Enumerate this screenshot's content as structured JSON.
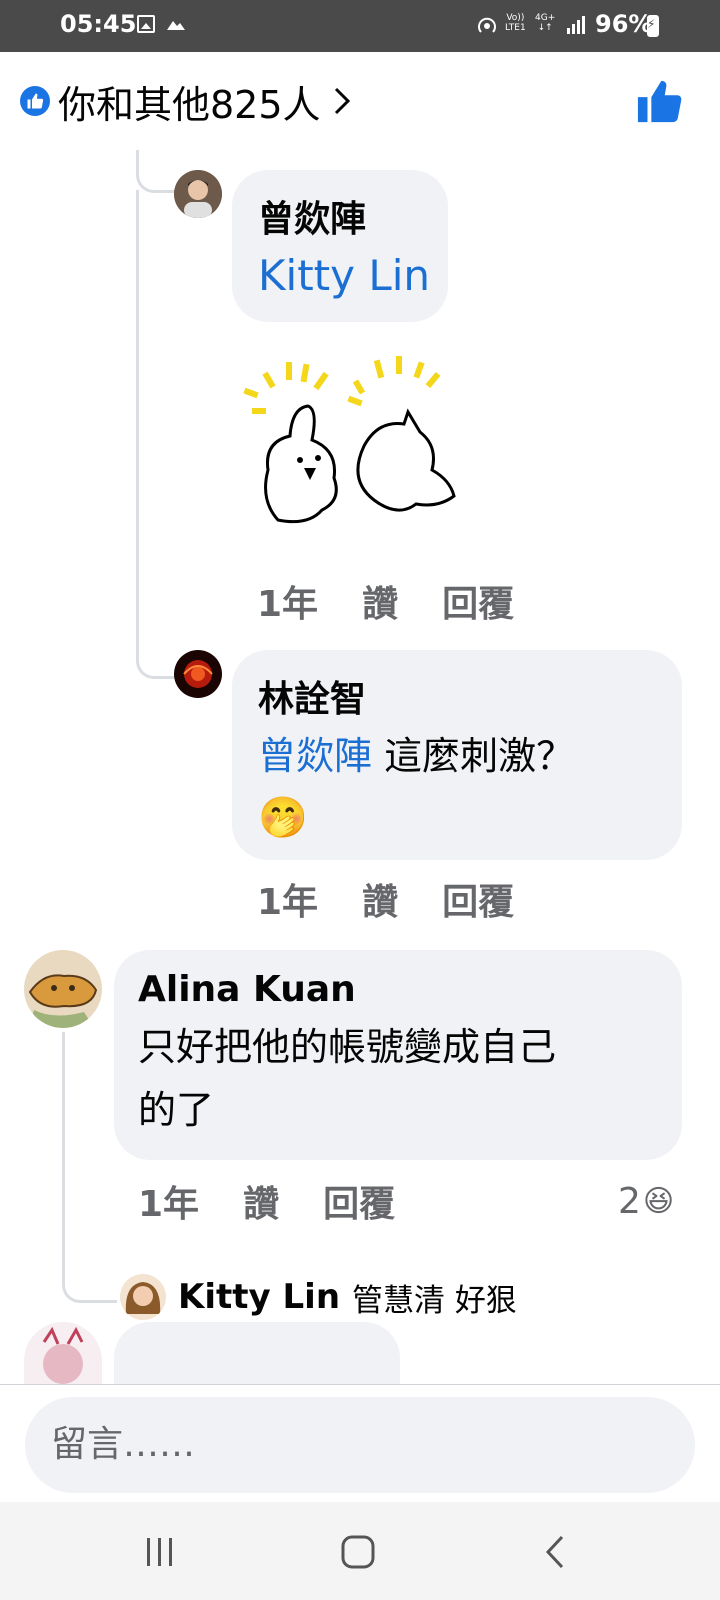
{
  "status_bar": {
    "time": "05:45",
    "volte_top": "Vo))",
    "volte_bottom": "LTE1",
    "network_top": "4G+",
    "network_bottom": "↓↑",
    "battery": "96%"
  },
  "reactions": {
    "summary": "你和其他825人",
    "like_color": "#1b74e4"
  },
  "comments": [
    {
      "author": "曾欻陣",
      "mention": "Kitty Lin",
      "text": "",
      "has_sticker": true,
      "time": "1年",
      "like_label": "讚",
      "reply_label": "回覆"
    },
    {
      "author": "林詮智",
      "mention": "曾欻陣",
      "text": "這麼刺激？",
      "emoji": "🤭",
      "time": "1年",
      "like_label": "讚",
      "reply_label": "回覆"
    },
    {
      "author": "Alina Kuan",
      "text_line1": "只好把他的帳號變成自己",
      "text_line2": "的了",
      "time": "1年",
      "like_label": "讚",
      "reply_label": "回覆",
      "reaction_count": "2",
      "reaction_emoji": "😆"
    }
  ],
  "reply_preview": {
    "name": "Kitty Lin",
    "text": "管慧清 好狠"
  },
  "comment_box": {
    "placeholder": "留言……"
  },
  "colors": {
    "mention": "#1b6fd3",
    "bubble": "#f0f2f5",
    "meta": "#65676b"
  }
}
